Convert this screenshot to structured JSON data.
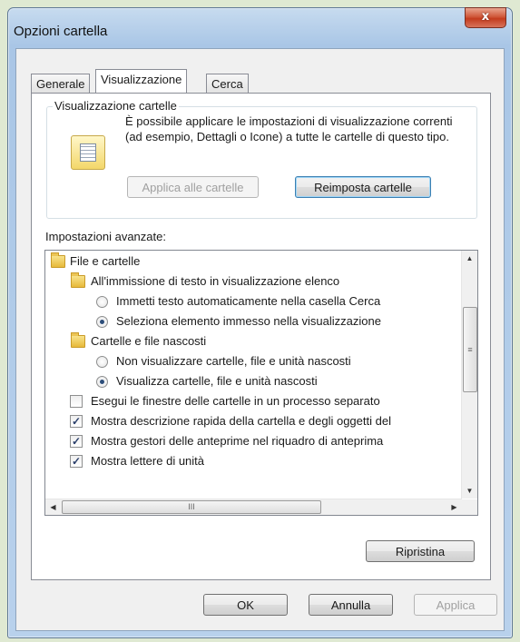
{
  "window": {
    "title": "Opzioni cartella",
    "close_glyph": "x"
  },
  "tabs": [
    {
      "label": "Generale"
    },
    {
      "label": "Visualizzazione"
    },
    {
      "label": "Cerca"
    }
  ],
  "active_tab": "Visualizzazione",
  "folder_view": {
    "group_title": "Visualizzazione cartelle",
    "description": "È possibile applicare le impostazioni di visualizzazione correnti (ad esempio, Dettagli o Icone) a tutte le cartelle di questo tipo.",
    "icon": "folder-view-icon",
    "apply_button": "Applica alle cartelle",
    "apply_enabled": false,
    "reset_button": "Reimposta cartelle"
  },
  "advanced": {
    "label": "Impostazioni avanzate:",
    "items": [
      {
        "type": "folder",
        "text": "File e cartelle"
      },
      {
        "type": "folder",
        "text": "All'immissione di testo in visualizzazione elenco"
      },
      {
        "type": "radio",
        "text": "Immetti testo automaticamente nella casella Cerca",
        "checked": false
      },
      {
        "type": "radio",
        "text": "Seleziona elemento immesso nella visualizzazione",
        "checked": true
      },
      {
        "type": "folder",
        "text": "Cartelle e file nascosti"
      },
      {
        "type": "radio",
        "text": "Non visualizzare cartelle, file e unità nascosti",
        "checked": false
      },
      {
        "type": "radio",
        "text": "Visualizza cartelle, file e unità nascosti",
        "checked": true
      },
      {
        "type": "check",
        "text": "Esegui le finestre delle cartelle in un processo separato",
        "checked": false
      },
      {
        "type": "check",
        "text": "Mostra descrizione rapida della cartella e degli oggetti del",
        "checked": true
      },
      {
        "type": "check",
        "text": "Mostra gestori delle anteprime nel riquadro di anteprima",
        "checked": true
      },
      {
        "type": "check",
        "text": "Mostra lettere di unità",
        "checked": true
      }
    ],
    "restore_button": "Ripristina"
  },
  "footer": {
    "ok": "OK",
    "cancel": "Annulla",
    "apply": "Applica",
    "apply_enabled": false
  },
  "glyphs": {
    "scroll_up": "▲",
    "scroll_down": "▼",
    "scroll_left": "◀",
    "scroll_right": "▶",
    "grip_vertical": "≡",
    "grip_horizontal": "III",
    "check": "✓"
  }
}
